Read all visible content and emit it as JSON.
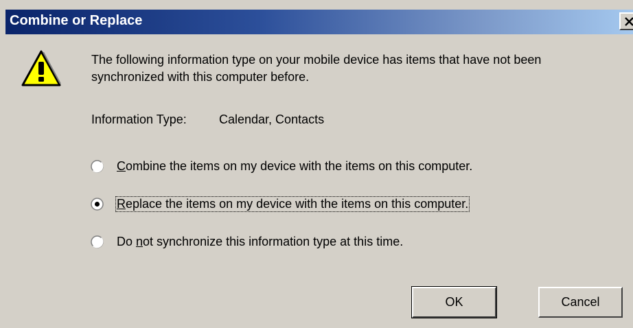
{
  "dialog": {
    "title": "Combine or Replace",
    "close_label": "×",
    "message": "The following information type on your mobile device has items that have not been\nsynchronized with this computer before.",
    "info_label": "Information Type:",
    "info_value": "Calendar, Contacts",
    "options": [
      {
        "prefix": "",
        "mnemonic": "C",
        "rest": "ombine the items on my device with the items on this computer.",
        "selected": false
      },
      {
        "prefix": "",
        "mnemonic": "R",
        "rest": "eplace the items on my device with the items on this computer.",
        "selected": true
      },
      {
        "prefix": "Do ",
        "mnemonic": "n",
        "rest": "ot synchronize this information type at this time.",
        "selected": false
      }
    ],
    "ok_label": "OK",
    "cancel_label": "Cancel"
  },
  "icons": {
    "warning": "warning-icon",
    "close": "close-icon"
  },
  "colors": {
    "dialog_bg": "#d4d0c8",
    "title_start": "#0a246a",
    "title_end": "#a6caf0",
    "warning_yellow": "#ffff00"
  }
}
